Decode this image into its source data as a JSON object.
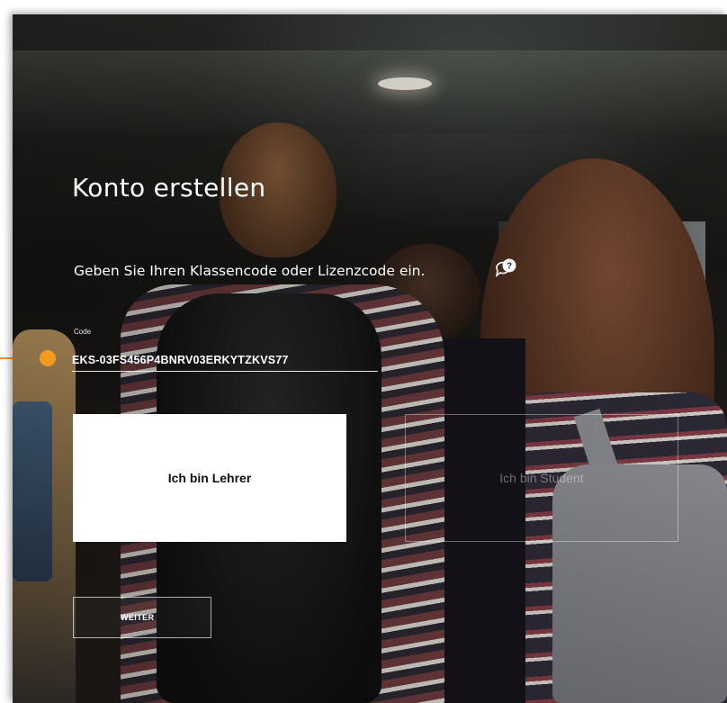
{
  "page": {
    "title": "Konto erstellen",
    "prompt": "Geben Sie Ihren Klassencode oder Lizenzcode ein.",
    "help_icon": "help-bubble-icon"
  },
  "code_field": {
    "label": "Code",
    "value": "EKS-03FS456P4BNRV03ERKYTZKVS77"
  },
  "roles": {
    "teacher_label": "Ich bin Lehrer",
    "student_label": "Ich bin Student"
  },
  "actions": {
    "next_label": "WEITER"
  },
  "colors": {
    "accent": "#f39a21",
    "text": "#ffffff",
    "selected_card": "#ffffff"
  }
}
